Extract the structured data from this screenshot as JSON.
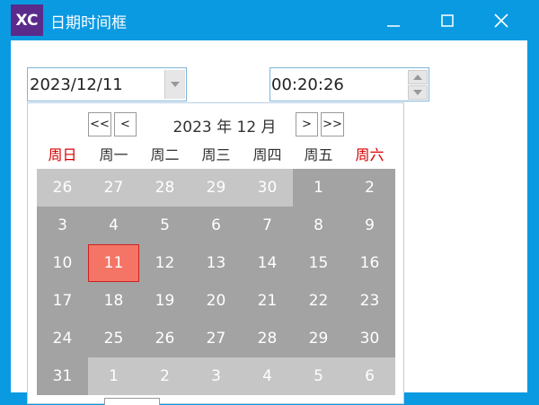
{
  "window": {
    "app_icon_text": "XC",
    "title": "日期时间框"
  },
  "date_field": {
    "value": "2023/12/11"
  },
  "time_field": {
    "value": "00:20:26"
  },
  "calendar": {
    "nav": {
      "prev_year": "<<",
      "prev_month": "<",
      "next_month": ">",
      "next_year": ">>"
    },
    "month_title": "2023 年 12 月",
    "weekdays": [
      "周日",
      "周一",
      "周二",
      "周三",
      "周四",
      "周五",
      "周六"
    ],
    "weeks": [
      [
        "26",
        "27",
        "28",
        "29",
        "30",
        "1",
        "2"
      ],
      [
        "3",
        "4",
        "5",
        "6",
        "7",
        "8",
        "9"
      ],
      [
        "10",
        "11",
        "12",
        "13",
        "14",
        "15",
        "16"
      ],
      [
        "17",
        "18",
        "19",
        "20",
        "21",
        "22",
        "23"
      ],
      [
        "24",
        "25",
        "26",
        "27",
        "28",
        "29",
        "30"
      ],
      [
        "31",
        "1",
        "2",
        "3",
        "4",
        "5",
        "6"
      ]
    ],
    "selected_day": "11",
    "colors": {
      "weekend_header": "#d90000",
      "in_month": "#a3a3a3",
      "out_month": "#c6c6c6",
      "selected": "#f47566"
    }
  }
}
